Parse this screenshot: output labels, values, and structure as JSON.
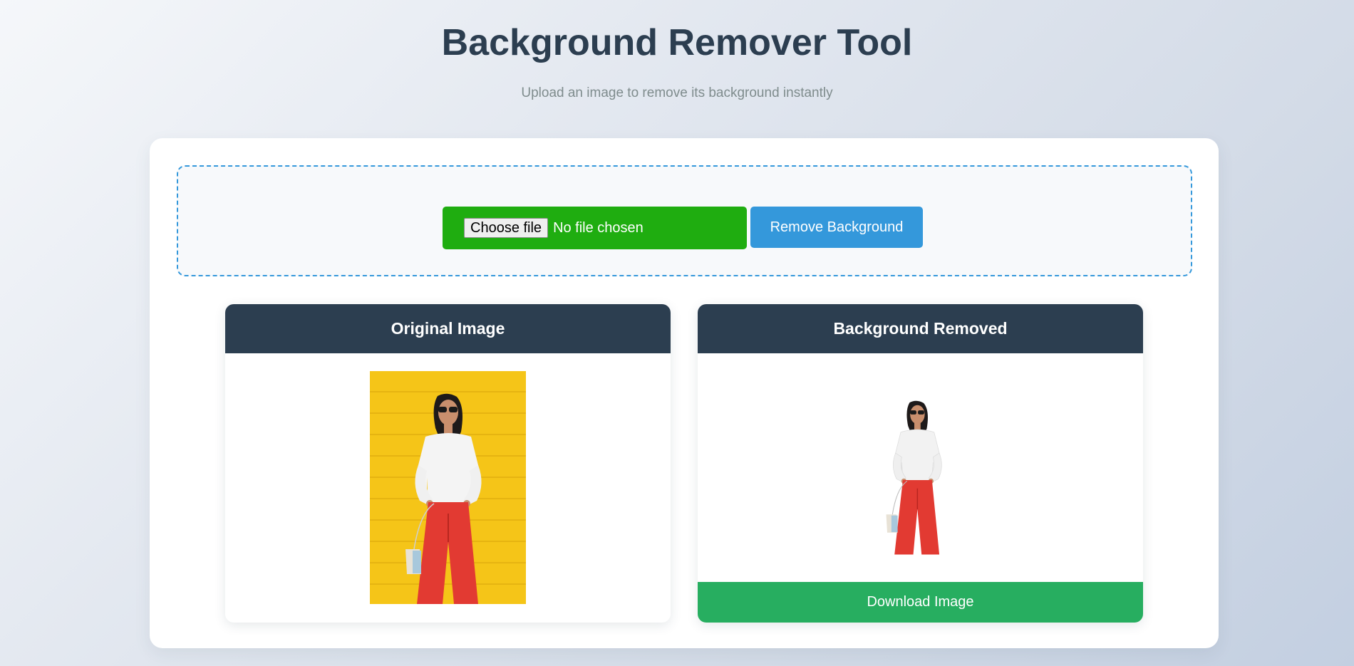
{
  "header": {
    "title": "Background Remover Tool",
    "subtitle": "Upload an image to remove its background instantly"
  },
  "upload": {
    "choose_file_label": "Choose file",
    "no_file_text": "No file chosen",
    "remove_button_label": "Remove Background"
  },
  "panels": {
    "original_title": "Original Image",
    "removed_title": "Background Removed",
    "download_label": "Download Image"
  },
  "colors": {
    "title": "#2c3e50",
    "accent_blue": "#3498db",
    "file_input_green": "#1fad10",
    "download_green": "#27ae60",
    "panel_header": "#2c3e50"
  }
}
